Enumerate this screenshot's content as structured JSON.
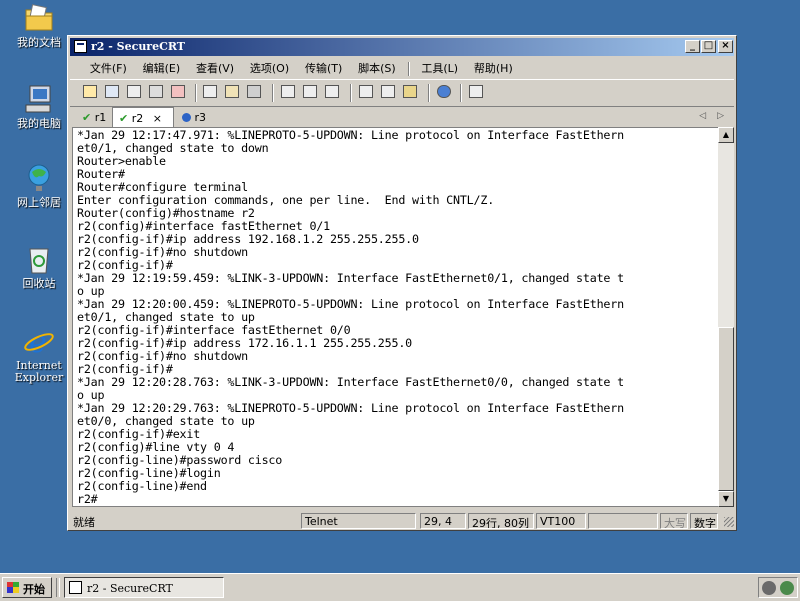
{
  "desktop": {
    "icons": [
      {
        "label": "我的文档",
        "icon": "folder-documents-icon"
      },
      {
        "label": "我的电脑",
        "icon": "computer-icon"
      },
      {
        "label": "网上邻居",
        "icon": "network-icon"
      },
      {
        "label": "回收站",
        "icon": "recycle-bin-icon"
      },
      {
        "label": "Internet Explorer",
        "icon": "internet-explorer-icon"
      }
    ]
  },
  "window": {
    "title": "r2 - SecureCRT",
    "controls": {
      "minimize": "_",
      "maximize": "□",
      "close": "×"
    }
  },
  "menu": [
    "文件(F)",
    "编辑(E)",
    "查看(V)",
    "选项(O)",
    "传输(T)",
    "脚本(S)",
    "工具(L)",
    "帮助(H)"
  ],
  "tabs": [
    {
      "label": "r1",
      "status": "connected"
    },
    {
      "label": "r2",
      "status": "connected",
      "active": true,
      "close": "×"
    },
    {
      "label": "r3",
      "status": "info"
    }
  ],
  "tab_nav": {
    "left": "◁",
    "right": "▷"
  },
  "terminal": {
    "lines": [
      "*Jan 29 12:17:47.971: %LINEPROTO-5-UPDOWN: Line protocol on Interface FastEthern",
      "et0/1, changed state to down",
      "Router>enable",
      "Router#",
      "Router#configure terminal",
      "Enter configuration commands, one per line.  End with CNTL/Z.",
      "Router(config)#hostname r2",
      "r2(config)#interface fastEthernet 0/1",
      "r2(config-if)#ip address 192.168.1.2 255.255.255.0",
      "r2(config-if)#no shutdown",
      "r2(config-if)#",
      "*Jan 29 12:19:59.459: %LINK-3-UPDOWN: Interface FastEthernet0/1, changed state t",
      "o up",
      "*Jan 29 12:20:00.459: %LINEPROTO-5-UPDOWN: Line protocol on Interface FastEthern",
      "et0/1, changed state to up",
      "r2(config-if)#interface fastEthernet 0/0",
      "r2(config-if)#ip address 172.16.1.1 255.255.255.0",
      "r2(config-if)#no shutdown",
      "r2(config-if)#",
      "*Jan 29 12:20:28.763: %LINK-3-UPDOWN: Interface FastEthernet0/0, changed state t",
      "o up",
      "*Jan 29 12:20:29.763: %LINEPROTO-5-UPDOWN: Line protocol on Interface FastEthern",
      "et0/0, changed state to up",
      "r2(config-if)#exit",
      "r2(config)#line vty 0 4",
      "r2(config-line)#password cisco",
      "r2(config-line)#login",
      "r2(config-line)#end",
      "r2#"
    ]
  },
  "status": {
    "ready": "就绪",
    "protocol": "Telnet",
    "cursor": "29,  4",
    "size": "29行, 80列",
    "emulation": "VT100",
    "caps": "大写",
    "num": "数字"
  },
  "taskbar": {
    "start": "开始",
    "task": "r2 - SecureCRT"
  }
}
